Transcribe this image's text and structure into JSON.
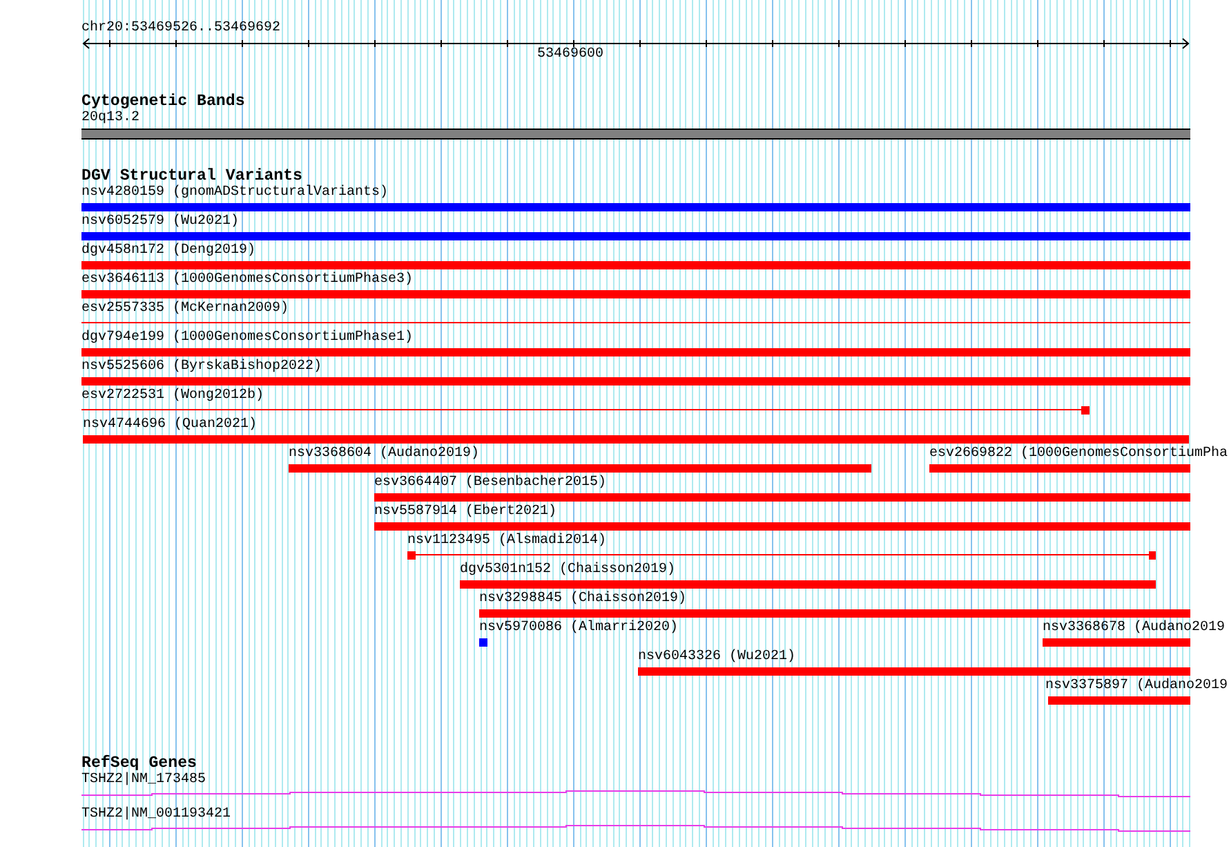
{
  "ruler": {
    "location": "chr20:53469526..53469692",
    "tick_labels": [
      "53469600"
    ]
  },
  "cytogenetic_bands": {
    "title": "Cytogenetic Bands",
    "bands": [
      {
        "label": "20q13.2"
      }
    ]
  },
  "dgv_structural_variants": {
    "title": "DGV Structural Variants",
    "rows": [
      {
        "features": [
          {
            "label": "nsv4280159 (gnomADStructuralVariants)",
            "kind": "block",
            "color": "#0000ff"
          }
        ]
      },
      {
        "features": [
          {
            "label": "nsv6052579 (Wu2021)",
            "kind": "block",
            "color": "#0000ff"
          }
        ]
      },
      {
        "features": [
          {
            "label": "dgv458n172 (Deng2019)",
            "kind": "block",
            "color": "#ff0000"
          }
        ]
      },
      {
        "features": [
          {
            "label": "esv3646113 (1000GenomesConsortiumPhase3)",
            "kind": "block",
            "color": "#ff0000"
          }
        ]
      },
      {
        "features": [
          {
            "label": "esv2557335 (McKernan2009)",
            "kind": "line",
            "color": "#ff0000"
          }
        ]
      },
      {
        "features": [
          {
            "label": "dgv794e199 (1000GenomesConsortiumPhase1)",
            "kind": "block",
            "color": "#ff0000"
          }
        ]
      },
      {
        "features": [
          {
            "label": "nsv5525606 (ByrskaBishop2022)",
            "kind": "block",
            "color": "#ff0000"
          }
        ]
      },
      {
        "features": [
          {
            "label": "esv2722531 (Wong2012b)",
            "kind": "line",
            "color": "#ff0000"
          }
        ]
      },
      {
        "features": [
          {
            "label": "nsv4744696 (Quan2021)",
            "kind": "block",
            "color": "#ff0000"
          }
        ]
      },
      {
        "features": [
          {
            "label": "nsv3368604 (Audano2019)",
            "kind": "block",
            "color": "#ff0000"
          },
          {
            "label": "esv2669822 (1000GenomesConsortiumPha",
            "kind": "block",
            "color": "#ff0000"
          }
        ]
      },
      {
        "features": [
          {
            "label": "esv3664407 (Besenbacher2015)",
            "kind": "block",
            "color": "#ff0000"
          }
        ]
      },
      {
        "features": [
          {
            "label": "nsv5587914 (Ebert2021)",
            "kind": "block",
            "color": "#ff0000"
          }
        ]
      },
      {
        "features": [
          {
            "label": "nsv1123495 (Alsmadi2014)",
            "kind": "line",
            "color": "#ff0000"
          }
        ]
      },
      {
        "features": [
          {
            "label": "dgv5301n152 (Chaisson2019)",
            "kind": "block",
            "color": "#ff0000"
          }
        ]
      },
      {
        "features": [
          {
            "label": "nsv3298845 (Chaisson2019)",
            "kind": "block",
            "color": "#ff0000"
          }
        ]
      },
      {
        "features": [
          {
            "label": "nsv5970086 (Almarri2020)",
            "kind": "block",
            "color": "#0000ff"
          },
          {
            "label": "nsv3368678 (Audano2019",
            "kind": "block",
            "color": "#ff0000"
          }
        ]
      },
      {
        "features": [
          {
            "label": "nsv6043326 (Wu2021)",
            "kind": "block",
            "color": "#ff0000"
          }
        ]
      },
      {
        "features": [
          {
            "label": "nsv3375897 (Audano2019",
            "kind": "block",
            "color": "#ff0000"
          }
        ]
      }
    ]
  },
  "refseq_genes": {
    "title": "RefSeq Genes",
    "transcripts": [
      {
        "label": "TSHZ2|NM_173485"
      },
      {
        "label": "TSHZ2|NM_001193421"
      }
    ]
  }
}
